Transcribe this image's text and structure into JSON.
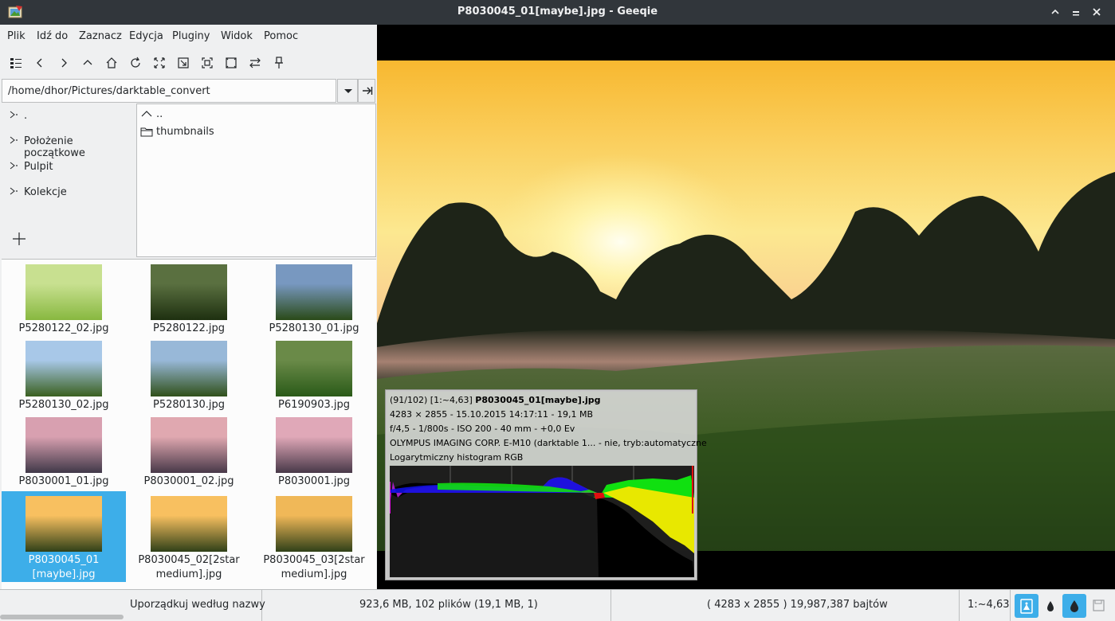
{
  "window": {
    "title": "P8030045_01[maybe].jpg - Geeqie",
    "controls": [
      "chevron-up",
      "minimize",
      "maximize",
      "close"
    ]
  },
  "menu": [
    "Plik",
    "Idź do",
    "Zaznacz",
    "Edycja",
    "Pluginy",
    "Widok",
    "Pomoc"
  ],
  "toolbar": [
    "thumbnails",
    "back",
    "forward",
    "up",
    "home",
    "refresh",
    "zoom-in",
    "zoom-out",
    "zoom-fit",
    "zoom-100",
    "preferences",
    "pin"
  ],
  "path": {
    "value": "/home/dhor/Pictures/darktable_convert"
  },
  "bookmarks": [
    ".",
    "Położenie początkowe",
    "Pulpit",
    "Kolekcje"
  ],
  "dirlist": [
    {
      "name": "..",
      "icon": "parent"
    },
    {
      "name": "thumbnails",
      "icon": "folder"
    }
  ],
  "thumbnails": [
    {
      "caption": "P5280122_02.jpg",
      "colors": [
        "#c8e090",
        "#88b840"
      ],
      "selected": false
    },
    {
      "caption": "P5280122.jpg",
      "colors": [
        "#5a7040",
        "#1e3010"
      ],
      "selected": false
    },
    {
      "caption": "P5280130_01.jpg",
      "colors": [
        "#7898c0",
        "#2a4a18"
      ],
      "selected": false
    },
    {
      "caption": "P5280130_02.jpg",
      "colors": [
        "#a8c8e8",
        "#3a6020"
      ],
      "selected": false
    },
    {
      "caption": "P5280130.jpg",
      "colors": [
        "#98b8d8",
        "#30501a"
      ],
      "selected": false
    },
    {
      "caption": "P6190903.jpg",
      "colors": [
        "#6a8a48",
        "#2a5a18"
      ],
      "selected": false
    },
    {
      "caption": "P8030001_01.jpg",
      "colors": [
        "#d8a0b0",
        "#403848"
      ],
      "selected": false
    },
    {
      "caption": "P8030001_02.jpg",
      "colors": [
        "#e0a8b0",
        "#483848"
      ],
      "selected": false
    },
    {
      "caption": "P8030001.jpg",
      "colors": [
        "#e0a8b8",
        "#483848"
      ],
      "selected": false
    },
    {
      "caption": "P8030045_01\n[maybe].jpg",
      "colors": [
        "#f8c060",
        "#304018"
      ],
      "selected": true
    },
    {
      "caption": "P8030045_02[2star\nmedium].jpg",
      "colors": [
        "#f8c060",
        "#304018"
      ],
      "selected": false
    },
    {
      "caption": "P8030045_03[2star\nmedium].jpg",
      "colors": [
        "#f0b858",
        "#304018"
      ],
      "selected": false
    }
  ],
  "overlay": {
    "line1_prefix": "(91/102) [1:~4,63] ",
    "line1_name": "P8030045_01[maybe].jpg",
    "line2": "4283 × 2855 - 15.10.2015 14:17:11 - 19,1 MB",
    "line3": "f/4,5 - 1/800s - ISO 200 - 40 mm - +0,0 Ev",
    "line4": "OLYMPUS IMAGING CORP. E-M10 (darktable 1... - nie, tryb:automatyczne",
    "line5": "Logarytmiczny histogram RGB"
  },
  "status": {
    "sort": "Uporządkuj według nazwy",
    "collection": "923,6 MB, 102 plików (19,1 MB, 1)",
    "dimensions": "( 4283 x 2855 ) 19,987,387 bajtów",
    "zoom": "1:~4,63"
  },
  "colors": {
    "accent": "#3daee9",
    "titlebar": "#31363b",
    "window_bg": "#eff0f1"
  }
}
